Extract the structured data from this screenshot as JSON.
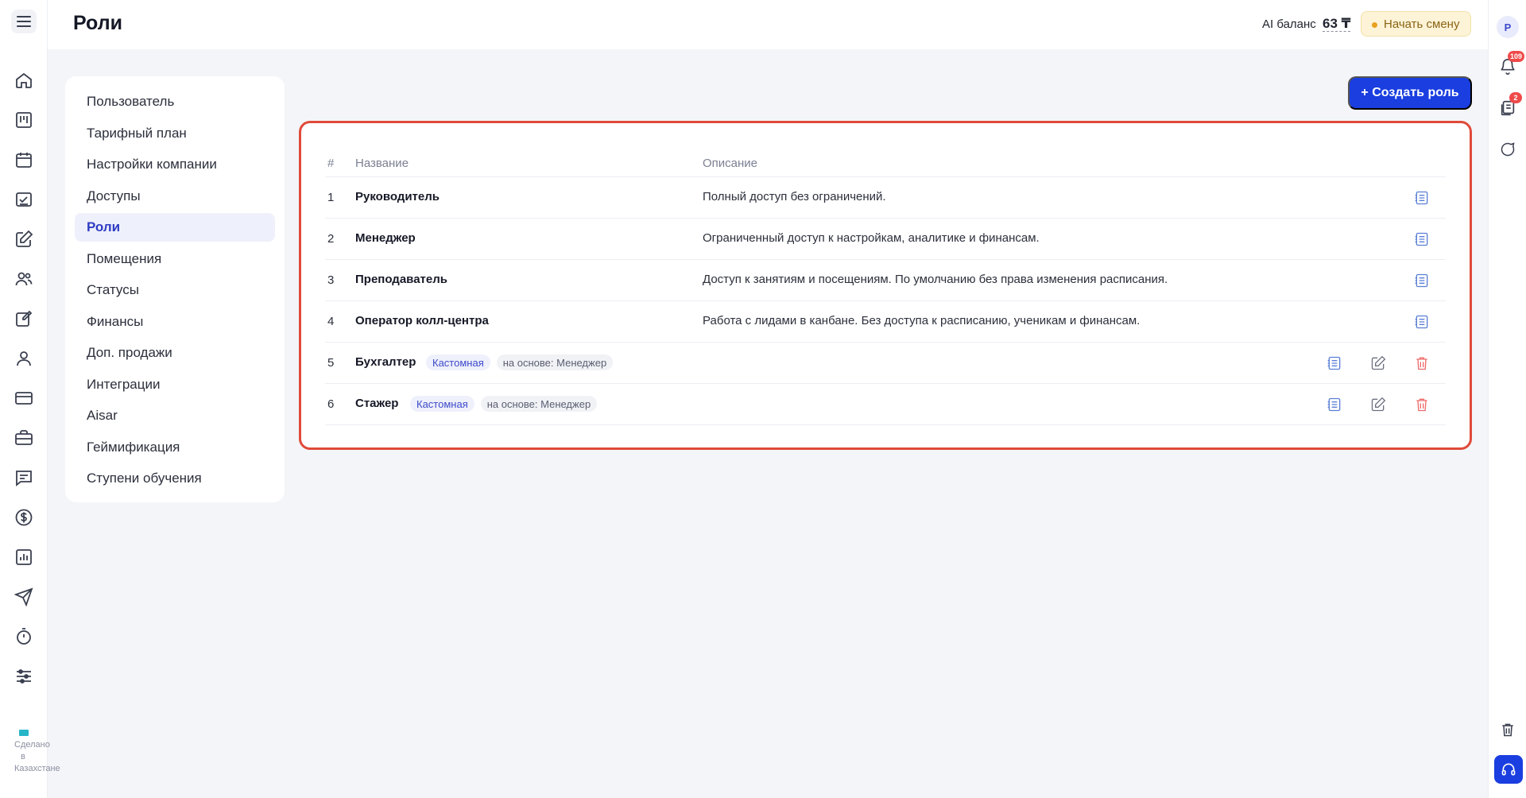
{
  "header": {
    "title": "Роли",
    "ai_balance_label": "AI баланс",
    "ai_balance_value": "63 ₸",
    "start_shift_label": "Начать смену"
  },
  "footer": {
    "made_in_line1": "Сделано",
    "made_in_line2": "в",
    "made_in_line3": "Казахстане"
  },
  "right_rail": {
    "avatar_letter": "Р",
    "notifications_count": "109",
    "tasks_count": "2"
  },
  "settings_menu": [
    {
      "label": "Пользователь"
    },
    {
      "label": "Тарифный план"
    },
    {
      "label": "Настройки компании"
    },
    {
      "label": "Доступы"
    },
    {
      "label": "Роли",
      "active": true
    },
    {
      "label": "Помещения"
    },
    {
      "label": "Статусы"
    },
    {
      "label": "Финансы"
    },
    {
      "label": "Доп. продажи"
    },
    {
      "label": "Интеграции"
    },
    {
      "label": "Aisar"
    },
    {
      "label": "Геймификация"
    },
    {
      "label": "Ступени обучения"
    }
  ],
  "create_role_label": "+ Создать роль",
  "table": {
    "columns": [
      "#",
      "Название",
      "Описание"
    ],
    "rows": [
      {
        "num": "1",
        "name": "Руководитель",
        "desc": "Полный доступ без ограничений."
      },
      {
        "num": "2",
        "name": "Менеджер",
        "desc": "Ограниченный доступ к настройкам, аналитике и финансам."
      },
      {
        "num": "3",
        "name": "Преподаватель",
        "desc": "Доступ к занятиям и посещениям. По умолчанию без права изменения расписания."
      },
      {
        "num": "4",
        "name": "Оператор колл-центра",
        "desc": "Работа с лидами в канбане. Без доступа к расписанию, ученикам и финансам."
      },
      {
        "num": "5",
        "name": "Бухгалтер",
        "custom_tag": "Кастомная",
        "base_tag": "на основе: Менеджер"
      },
      {
        "num": "6",
        "name": "Стажер",
        "custom_tag": "Кастомная",
        "base_tag": "на основе: Менеджер"
      }
    ]
  },
  "colors": {
    "accent": "#1a3ee0",
    "highlight_border": "#e04a3a",
    "delete_icon": "#ef6a6a",
    "view_icon": "#5b7fd6"
  }
}
